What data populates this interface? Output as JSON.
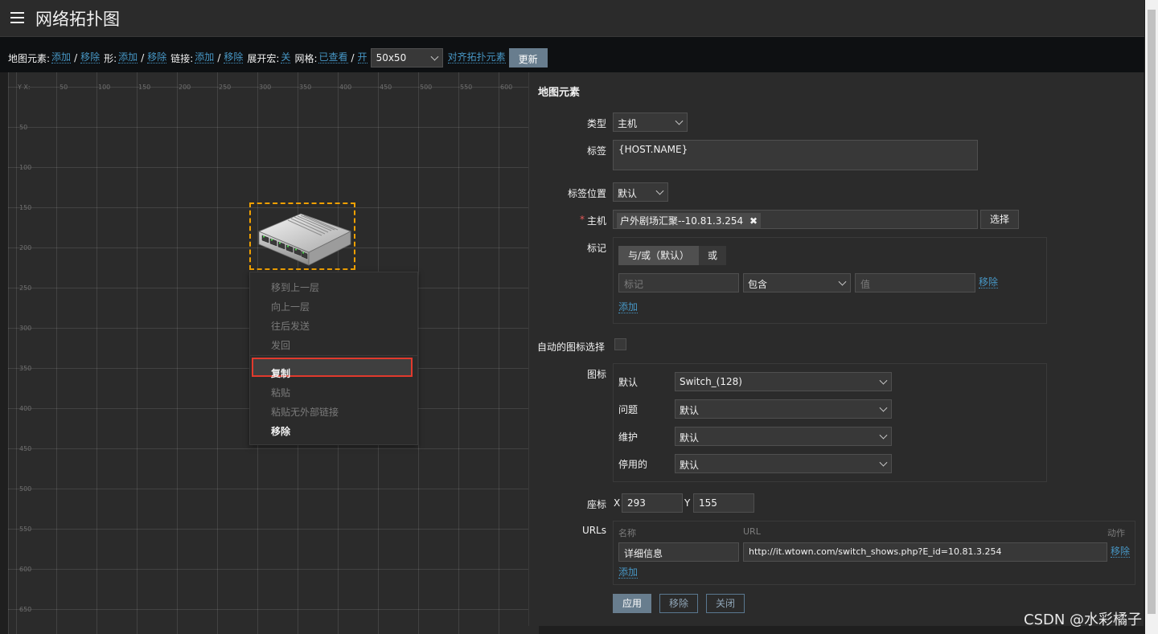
{
  "header": {
    "title": "网络拓扑图"
  },
  "toolbar": {
    "map_elements_label": "地图元素:",
    "map_add": "添加",
    "map_remove": "移除",
    "shape_label": "形:",
    "shape_add": "添加",
    "shape_remove": "移除",
    "link_label": "链接:",
    "link_add": "添加",
    "link_remove": "移除",
    "expand_label": "展开宏:",
    "expand_value": "关",
    "grid_label": "网格:",
    "grid_shown": "已查看",
    "grid_on": "开",
    "grid_size": "50x50",
    "align": "对齐拓扑元素",
    "update": "更新"
  },
  "map": {
    "x_ticks": [
      "Y X:",
      "50",
      "100",
      "150",
      "200",
      "250",
      "300",
      "350",
      "400",
      "450",
      "500",
      "550",
      "600"
    ],
    "y_ticks": [
      "50",
      "100",
      "150",
      "200",
      "250",
      "300",
      "350",
      "400",
      "450",
      "500",
      "550",
      "600",
      "650"
    ]
  },
  "context_menu": {
    "items": [
      "移到上一层",
      "向上一层",
      "往后发送",
      "发回",
      "复制",
      "粘贴",
      "粘贴无外部链接",
      "移除"
    ]
  },
  "panel": {
    "title": "地图元素",
    "type_label": "类型",
    "type_value": "主机",
    "label_label": "标签",
    "label_value": "{HOST.NAME}",
    "label_pos_label": "标签位置",
    "label_pos_value": "默认",
    "required_mark": "*",
    "host_label": "主机",
    "host_value": "户外剧场汇聚--10.81.3.254",
    "host_remove": "✖",
    "select_button": "选择",
    "tags_label": "标记",
    "tag_andor": "与/或（默认）",
    "tag_or": "或",
    "tag_placeholder": "标记",
    "tag_op": "包含",
    "tag_value_placeholder": "值",
    "tag_remove": "移除",
    "tag_add": "添加",
    "auto_icon_label": "自动的图标选择",
    "icons_label": "图标",
    "icon_rows": [
      {
        "label": "默认",
        "value": "Switch_(128)"
      },
      {
        "label": "问题",
        "value": "默认"
      },
      {
        "label": "维护",
        "value": "默认"
      },
      {
        "label": "停用的",
        "value": "默认"
      }
    ],
    "coord_label": "座标",
    "x_label": "X",
    "x_value": "293",
    "y_label": "Y",
    "y_value": "155",
    "urls_label": "URLs",
    "url_name_header": "名称",
    "url_header": "URL",
    "url_action_header": "动作",
    "url_name": "详细信息",
    "url_value": "http://it.wtown.com/switch_shows.php?E_id=10.81.3.254",
    "url_remove": "移除",
    "url_add": "添加",
    "apply": "应用",
    "remove": "移除",
    "close": "关闭"
  },
  "watermark": "CSDN @水彩橘子",
  "colors": {
    "link": "#4796c4",
    "highlight_border": "#e23a2d",
    "selection_border": "#f0a000",
    "primary_button": "#687d8e"
  }
}
